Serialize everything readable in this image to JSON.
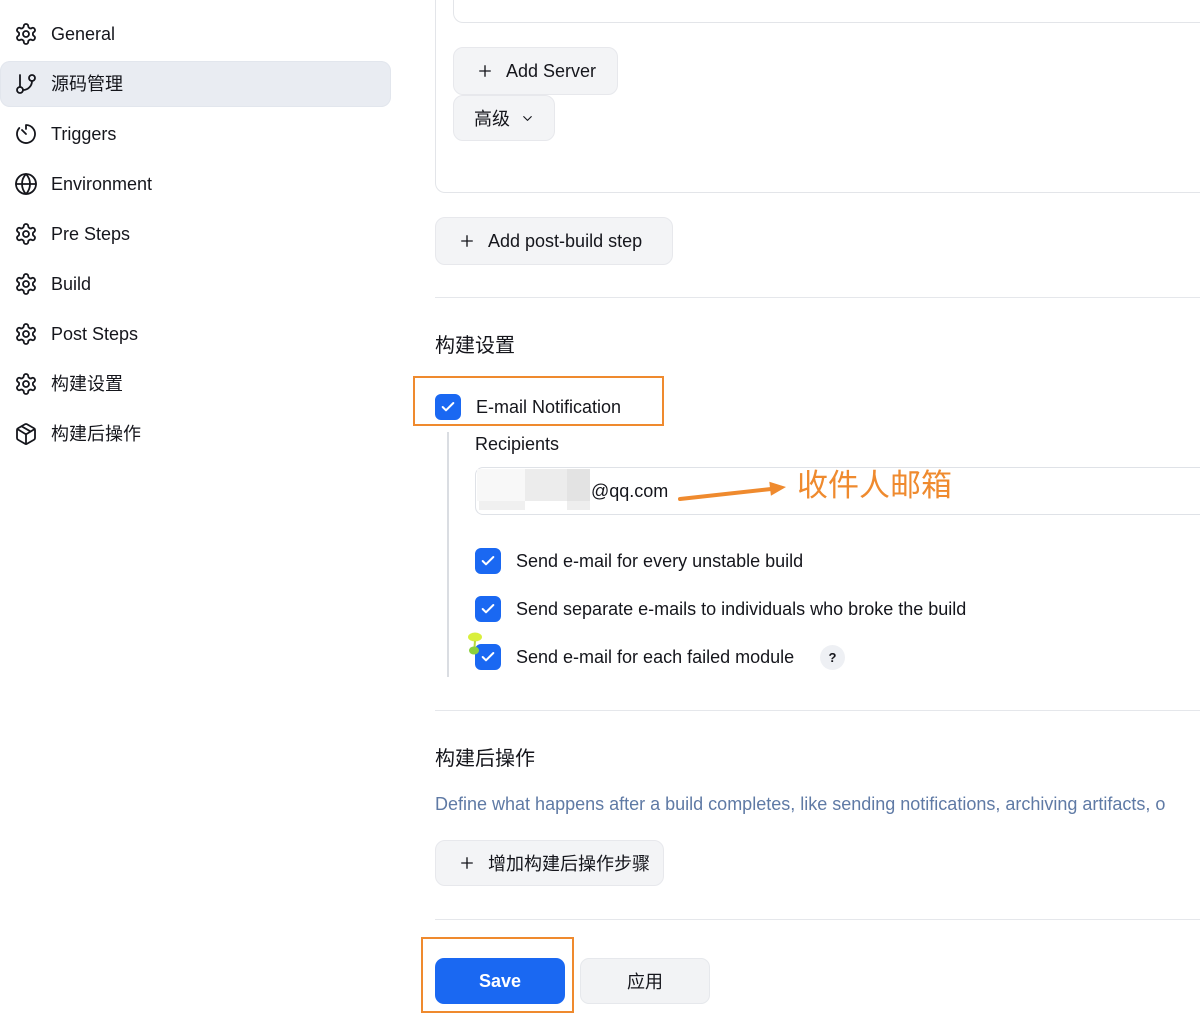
{
  "colors": {
    "accent": "#1a68f2",
    "annotation": "#ef8a2e",
    "description": "#5f7aa5",
    "text": "#15161c"
  },
  "sidebar": {
    "items": [
      {
        "label": "General",
        "icon": "gear-icon",
        "selected": false
      },
      {
        "label": "源码管理",
        "icon": "git-branch-icon",
        "selected": true
      },
      {
        "label": "Triggers",
        "icon": "timer-icon",
        "selected": false
      },
      {
        "label": "Environment",
        "icon": "globe-icon",
        "selected": false
      },
      {
        "label": "Pre Steps",
        "icon": "gear-icon",
        "selected": false
      },
      {
        "label": "Build",
        "icon": "gear-icon",
        "selected": false
      },
      {
        "label": "Post Steps",
        "icon": "gear-icon",
        "selected": false
      },
      {
        "label": "构建设置",
        "icon": "gear-icon",
        "selected": false
      },
      {
        "label": "构建后操作",
        "icon": "package-icon",
        "selected": false
      }
    ]
  },
  "scm": {
    "add_server": {
      "label": "Add Server",
      "icon": "plus-icon"
    },
    "advanced": {
      "label": "高级",
      "icon": "chevron-down-icon"
    }
  },
  "post_build_step": {
    "label": "Add post-build step",
    "icon": "plus-icon"
  },
  "build_settings": {
    "heading": "构建设置",
    "email_notification": {
      "label": "E-mail Notification",
      "checked": true
    },
    "recipients": {
      "label": "Recipients",
      "value": "@qq.com"
    },
    "options": [
      {
        "label": "Send e-mail for every unstable build",
        "checked": true
      },
      {
        "label": "Send separate e-mails to individuals who broke the build",
        "checked": true
      },
      {
        "label": "Send e-mail for each failed module",
        "checked": true,
        "help": "?"
      }
    ]
  },
  "annotation": {
    "label": "收件人邮箱"
  },
  "post_build_actions": {
    "heading": "构建后操作",
    "description": "Define what happens after a build completes, like sending notifications, archiving artifacts, o",
    "add_label": "增加构建后操作步骤",
    "add_icon": "plus-icon"
  },
  "footer": {
    "save_label": "Save",
    "apply_label": "应用"
  }
}
